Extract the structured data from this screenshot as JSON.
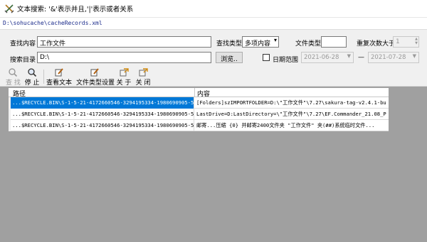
{
  "window": {
    "title": "文本搜索: '&'表示并且,'|'表示或者关系"
  },
  "pathbar": {
    "path": "D:\\sohucache\\cacheRecords.xml"
  },
  "form": {
    "search_content_label": "查找内容",
    "search_content_value": "工作文件",
    "search_type_label": "查找类型",
    "search_type_value": "多项内容",
    "file_type_label": "文件类型",
    "file_type_value": "",
    "repeat_label": "重复次数大于",
    "repeat_value": "1",
    "search_dir_label": "搜索目录",
    "search_dir_value": "D:\\",
    "browse_label": "浏览..",
    "date_range_label": "日期范围",
    "date_from": "2021-06-28",
    "date_sep": "—",
    "date_to": "2021-07-28"
  },
  "toolbar": {
    "find": "查 找",
    "stop": "停 止",
    "view_text": "查看文本",
    "file_type_settings": "文件类型设置",
    "about": "关 于",
    "close": "关 闭"
  },
  "grid": {
    "columns": [
      "路径",
      "内容"
    ],
    "rows": [
      {
        "path": "...$RECYCLE.BIN\\S-1-5-21-4172660546-3294195334-1980690905-5...",
        "content": "[Folders]szIMPORTFOLDER=D:\\\"工作文件\"\\7.27\\sakura-tag-v2.4.1-bu"
      },
      {
        "path": "...$RECYCLE.BIN\\S-1-5-21-4172660546-3294195334-1980690905-5...",
        "content": "LastDrive=D:LastDirectory=\\\"工作文件\"\\7.27\\EF.Commander_21.08_P"
      },
      {
        "path": "...$RECYCLE.BIN\\S-1-5-21-4172660546-3294195334-1980690905-5...",
        "content": "邮寄...压缩 {0} 并邮寄2400文件夹 \"工作文件\" 夹(##)系统临时文件..."
      }
    ]
  },
  "colors": {
    "selection": "#0078d7",
    "grid_background": "#a0a0a0",
    "path_text": "#1a2a8a"
  }
}
